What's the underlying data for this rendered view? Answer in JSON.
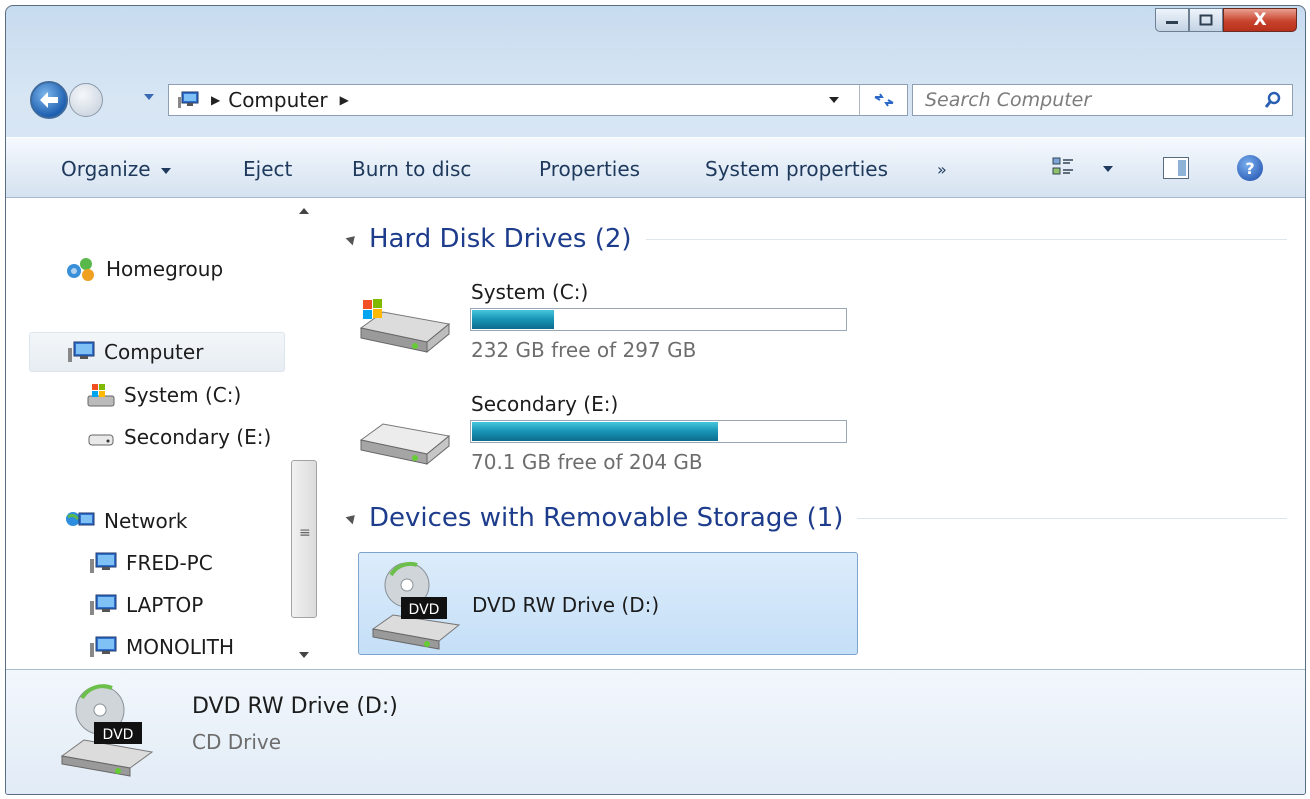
{
  "window": {
    "buttons": {
      "minimize": "minimize",
      "maximize": "maximize",
      "close": "X"
    }
  },
  "address_bar": {
    "crumbs": [
      "Computer"
    ],
    "separator": "▶"
  },
  "search": {
    "placeholder": "Search Computer"
  },
  "toolbar": {
    "organize": "Organize",
    "eject": "Eject",
    "burn": "Burn to disc",
    "properties": "Properties",
    "system_properties": "System properties",
    "more": "»",
    "help": "?"
  },
  "nav_pane": {
    "homegroup": "Homegroup",
    "computer": "Computer",
    "drives": [
      "System (C:)",
      "Secondary (E:)"
    ],
    "network": "Network",
    "network_items": [
      "FRED-PC",
      "LAPTOP",
      "MONOLITH"
    ]
  },
  "content": {
    "groups": [
      {
        "title": "Hard Disk Drives (2)"
      },
      {
        "title": "Devices with Removable Storage (1)"
      }
    ],
    "drives": [
      {
        "name": "System (C:)",
        "free": "232 GB free of 297 GB",
        "used_fraction": 0.22
      },
      {
        "name": "Secondary (E:)",
        "free": "70.1 GB free of 204 GB",
        "used_fraction": 0.66
      }
    ],
    "removable": [
      {
        "name": "DVD RW Drive (D:)",
        "badge": "DVD"
      }
    ]
  },
  "details_pane": {
    "name": "DVD RW Drive (D:)",
    "type": "CD Drive",
    "badge": "DVD"
  },
  "colors": {
    "accent": "#1e3c8c",
    "bar_fill": "#1893b5",
    "close": "#c8442d"
  }
}
